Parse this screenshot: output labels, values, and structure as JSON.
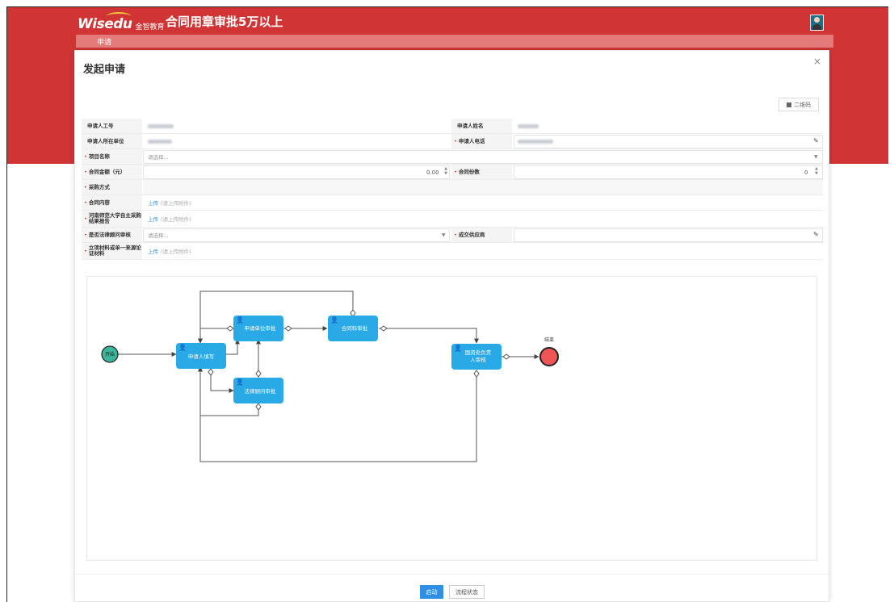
{
  "header": {
    "brand": "Wisedu",
    "brand_cn": "金智教育",
    "title": "合同用章审批5万以上",
    "tab": "申请"
  },
  "dialog": {
    "title": "发起申请",
    "close": "×",
    "qr_label": "二维码"
  },
  "form": {
    "applicant_id_label": "申请人工号",
    "applicant_name_label": "申请人姓名",
    "applicant_unit_label": "申请人所在单位",
    "applicant_phone_label": "申请人电话",
    "project_label": "项目名称",
    "project_placeholder": "请选择...",
    "amount_label": "合同金额（元）",
    "amount_value": "0.00",
    "copies_label": "合同份数",
    "copies_value": "0",
    "purchase_label": "采购方式",
    "content_label": "合同内容",
    "upload_label": "上传",
    "upload_hint": "(请上传附件)",
    "report_label": "河南师范大学自主采购结果报告",
    "legal_label": "是否法律顾问审核",
    "legal_placeholder": "请选择...",
    "supplier_label": "成交供应商",
    "material_label": "立项材料或单一来源论证材料"
  },
  "flow": {
    "start": "开始",
    "end": "结束",
    "nodes": {
      "applicant_fill": "申请人填写",
      "applying_unit": "申请单位审批",
      "contract_section": "合同科审批",
      "legal_counsel": "法律顾问审批",
      "asset_head_line1": "国资处负责",
      "asset_head_line2": "人审核"
    }
  },
  "footer": {
    "start_btn": "启动",
    "status_btn": "流程状态"
  },
  "colors": {
    "brand_red": "#d13434",
    "node_blue": "#29a9e6",
    "start_green": "#3cb59a",
    "end_red": "#f05454",
    "primary_btn": "#2f8fe5"
  }
}
